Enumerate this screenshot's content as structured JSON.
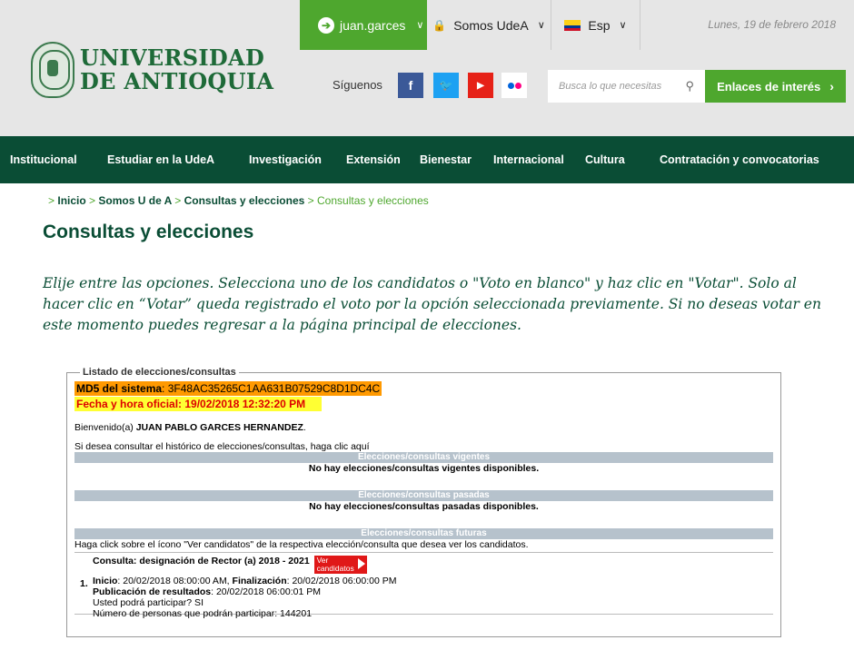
{
  "header": {
    "logo_line1": "UNIVERSIDAD",
    "logo_line2": "DE ANTIOQUIA",
    "user_button": "juan.garces",
    "somos_label": "Somos UdeA",
    "lang_label": "Esp",
    "date": "Lunes, 19 de febrero 2018",
    "siguenos": "Síguenos",
    "search_placeholder": "Busca lo que necesitas",
    "enlaces_label": "Enlaces de interés",
    "social": [
      "facebook-icon",
      "twitter-icon",
      "youtube-icon",
      "flickr-icon"
    ]
  },
  "nav": {
    "items": [
      "Institucional",
      "Estudiar en la UdeA",
      "Investigación",
      "Extensión",
      "Bienestar",
      "Internacional",
      "Cultura",
      "Contratación y convocatorias"
    ]
  },
  "breadcrumb": {
    "items": [
      "Inicio",
      "Somos U de A",
      "Consultas y elecciones"
    ],
    "current": "Consultas y elecciones",
    "separator": ">"
  },
  "page": {
    "title": "Consultas y elecciones",
    "intro": "Elije entre las opciones. Selecciona uno de los candidatos o \"Voto en blanco\" y haz clic en \"Votar\". Solo al hacer clic en “Votar” queda registrado el voto por la opción seleccionada previamente. Si no deseas votar en este momento puedes regresar a la página principal de elecciones."
  },
  "listado": {
    "legend": "Listado de elecciones/consultas",
    "md5_label": "MD5 del sistema",
    "md5_value": ": 3F48AC35265C1AA631B07529C8D1DC4C",
    "fecha": "Fecha y hora oficial: 19/02/2018 12:32:20 PM",
    "bienvenido_prefix": "Bienvenido(a) ",
    "user_name": "JUAN PABLO GARCES HERNANDEZ",
    "bienvenido_suffix": ".",
    "historico": "Si desea consultar el histórico de elecciones/consultas, haga clic aquí",
    "vigentes_header": "Elecciones/consultas vigentes",
    "vigentes_msg": "No hay elecciones/consultas vigentes disponibles.",
    "pasadas_header": "Elecciones/consultas pasadas",
    "pasadas_msg": "No hay elecciones/consultas pasadas disponibles.",
    "futuras_header": "Elecciones/consultas futuras",
    "futuras_help": "Haga click sobre el ícono \"Ver candidatos\" de la respectiva elección/consulta que desea ver los candidatos.",
    "consulta": {
      "number": "1.",
      "title": "Consulta: designación de Rector (a) 2018 - 2021",
      "ver_line1": "Ver",
      "ver_line2": "candidatos",
      "inicio_label": "Inicio",
      "inicio_value": ": 20/02/2018 08:00:00 AM, ",
      "fin_label": "Finalización",
      "fin_value": ": 20/02/2018 06:00:00 PM",
      "pub_label": "Publicación de resultados",
      "pub_value": ": 20/02/2018 06:00:01 PM",
      "participar": "Usted podrá participar? SI",
      "personas": "Número de personas que podrán participar: 144201"
    }
  }
}
